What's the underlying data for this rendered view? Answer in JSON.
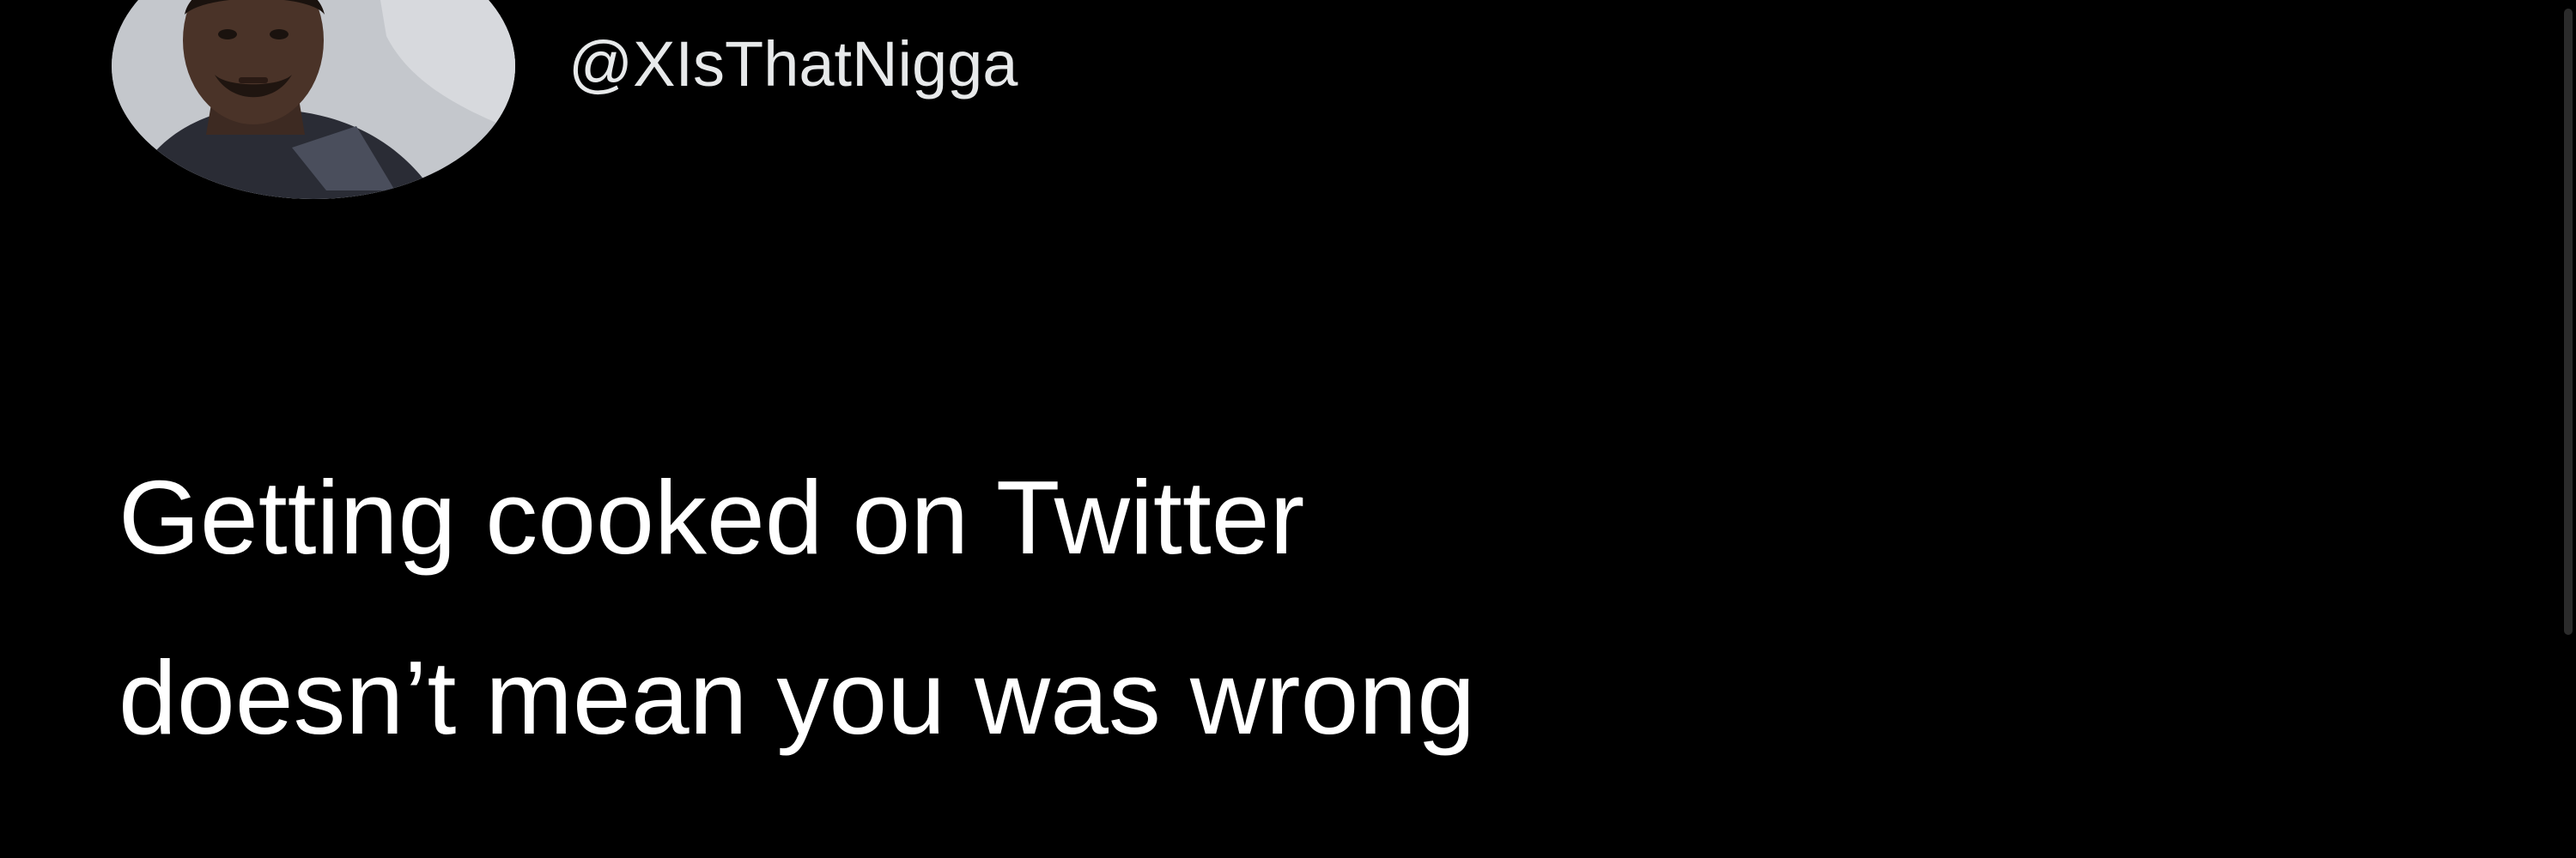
{
  "tweet": {
    "handle": "@XIsThatNigga",
    "text_lines": [
      "Getting cooked on Twitter",
      "doesn’t mean you was wrong"
    ]
  },
  "icons": {
    "avatar": "user-avatar-photo"
  },
  "colors": {
    "background": "#000000",
    "handle_text": "#e7e9ea",
    "tweet_text": "#ffffff"
  }
}
